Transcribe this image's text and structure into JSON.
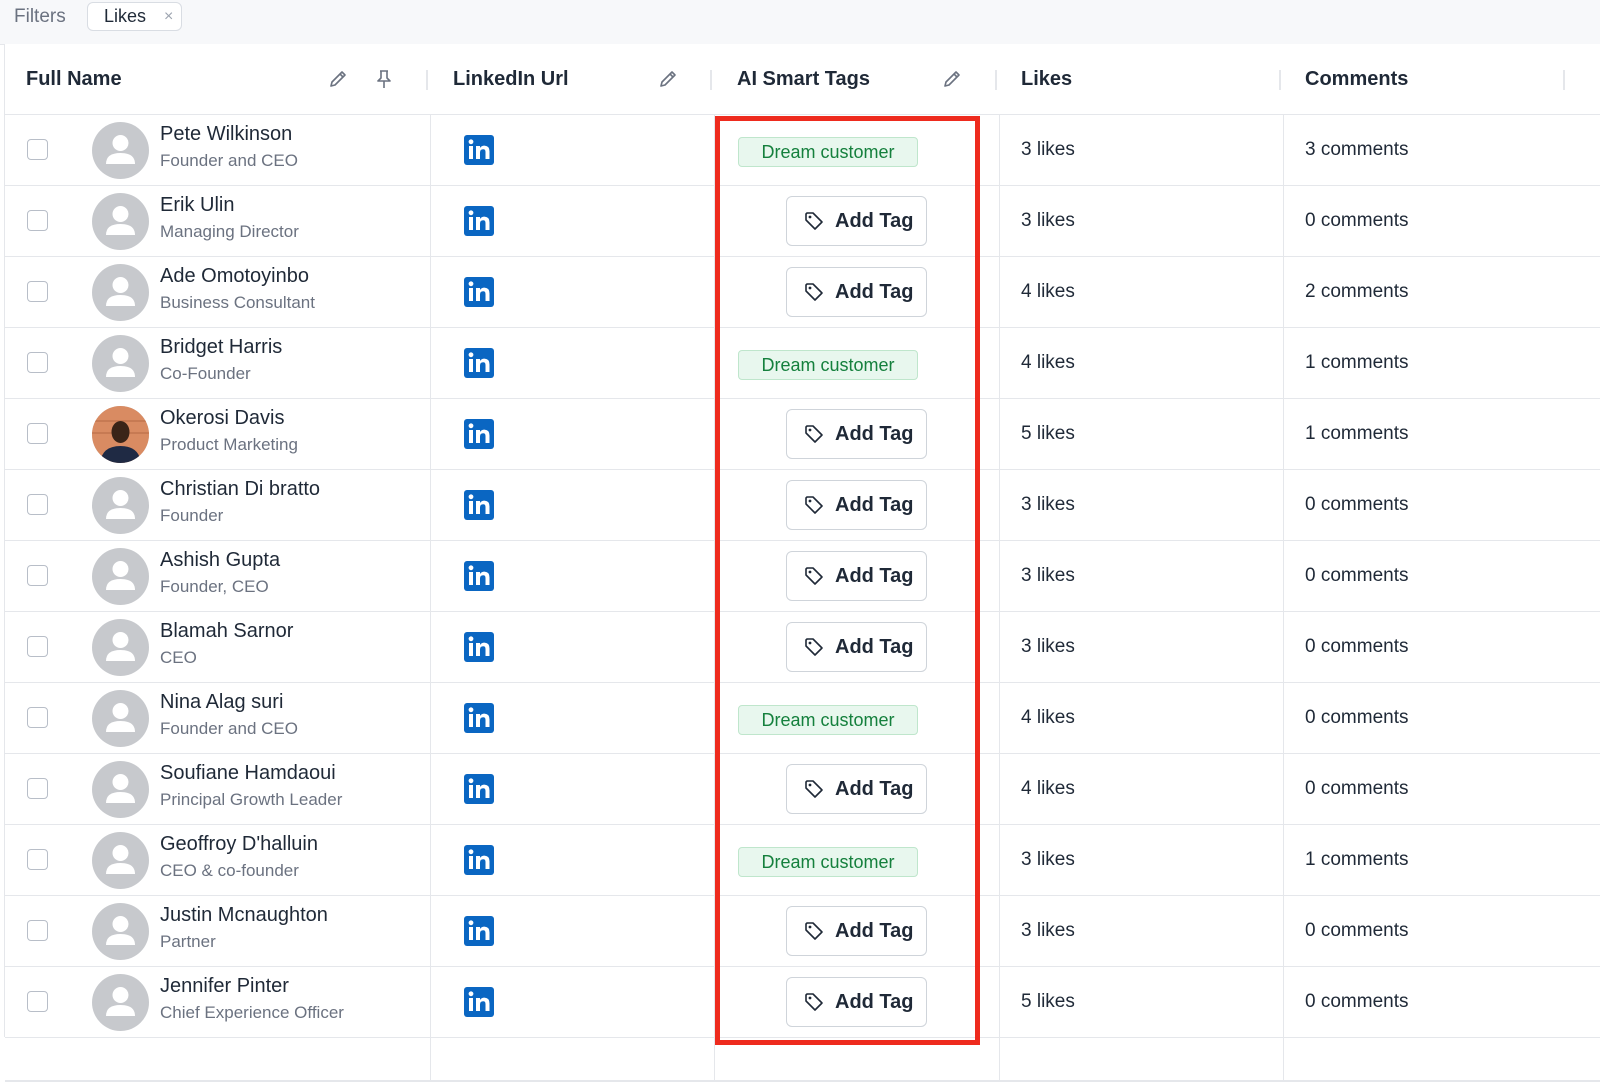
{
  "filters": {
    "label": "Filters",
    "chip": "Likes",
    "chip_close": "×"
  },
  "columns": {
    "full_name": "Full Name",
    "linkedin_url": "LinkedIn Url",
    "ai_smart_tags": "AI Smart Tags",
    "likes": "Likes",
    "comments": "Comments"
  },
  "add_tag_label": "Add Tag",
  "dream_tag_label": "Dream customer",
  "colors": {
    "linkedin": "#0a66c2",
    "tag_green": "#15803d",
    "highlight": "#ee2b1e"
  },
  "rows": [
    {
      "name": "Pete Wilkinson",
      "title": "Founder and CEO",
      "tag": "Dream customer",
      "likes": "3 likes",
      "comments": "3 comments"
    },
    {
      "name": "Erik Ulin",
      "title": "Managing Director",
      "tag": "",
      "likes": "3 likes",
      "comments": "0 comments"
    },
    {
      "name": "Ade Omotoyinbo",
      "title": "Business Consultant",
      "tag": "",
      "likes": "4 likes",
      "comments": "2 comments"
    },
    {
      "name": "Bridget Harris",
      "title": "Co-Founder",
      "tag": "Dream customer",
      "likes": "4 likes",
      "comments": "1 comments"
    },
    {
      "name": "Okerosi Davis",
      "title": "Product Marketing",
      "tag": "",
      "likes": "5 likes",
      "comments": "1 comments"
    },
    {
      "name": "Christian Di bratto",
      "title": "Founder",
      "tag": "",
      "likes": "3 likes",
      "comments": "0 comments"
    },
    {
      "name": "Ashish Gupta",
      "title": "Founder, CEO",
      "tag": "",
      "likes": "3 likes",
      "comments": "0 comments"
    },
    {
      "name": "Blamah Sarnor",
      "title": "CEO",
      "tag": "",
      "likes": "3 likes",
      "comments": "0 comments"
    },
    {
      "name": "Nina Alag suri",
      "title": "Founder and CEO",
      "tag": "Dream customer",
      "likes": "4 likes",
      "comments": "0 comments"
    },
    {
      "name": "Soufiane Hamdaoui",
      "title": "Principal Growth Leader",
      "tag": "",
      "likes": "4 likes",
      "comments": "0 comments"
    },
    {
      "name": "Geoffroy D'halluin",
      "title": "CEO & co-founder",
      "tag": "Dream customer",
      "likes": "3 likes",
      "comments": "1 comments"
    },
    {
      "name": "Justin Mcnaughton",
      "title": "Partner",
      "tag": "",
      "likes": "3 likes",
      "comments": "0 comments"
    },
    {
      "name": "Jennifer Pinter",
      "title": "Chief Experience Officer",
      "tag": "",
      "likes": "5 likes",
      "comments": "0 comments"
    }
  ]
}
